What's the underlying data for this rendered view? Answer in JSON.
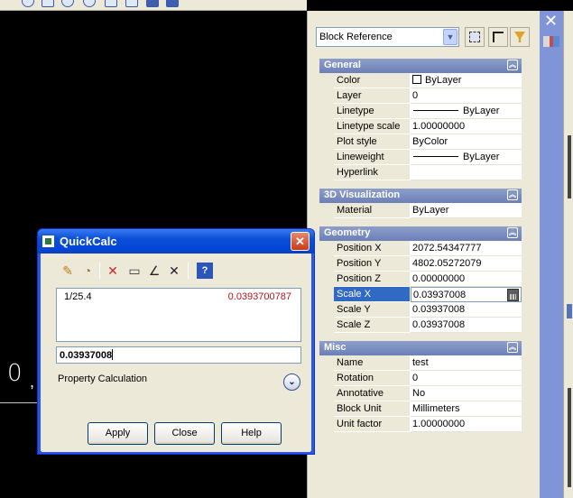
{
  "toolbar": {
    "icons": [
      "circle-icon",
      "rectangle-icon",
      "help-icon",
      "help-icon",
      "layers-icon",
      "window-icon",
      "save-icon",
      "save-icon"
    ]
  },
  "canvas": {
    "glyph_zero": "0",
    "glyph_comma": ","
  },
  "palette": {
    "object_type": "Block Reference",
    "sections": {
      "general": {
        "title": "General",
        "rows": [
          {
            "name": "Color",
            "value": "ByLayer"
          },
          {
            "name": "Layer",
            "value": "0"
          },
          {
            "name": "Linetype",
            "value": "ByLayer"
          },
          {
            "name": "Linetype scale",
            "value": "1.00000000"
          },
          {
            "name": "Plot style",
            "value": "ByColor"
          },
          {
            "name": "Lineweight",
            "value": "ByLayer"
          },
          {
            "name": "Hyperlink",
            "value": ""
          }
        ]
      },
      "viz3d": {
        "title": "3D Visualization",
        "rows": [
          {
            "name": "Material",
            "value": "ByLayer"
          }
        ]
      },
      "geometry": {
        "title": "Geometry",
        "rows": [
          {
            "name": "Position X",
            "value": "2072.54347777"
          },
          {
            "name": "Position Y",
            "value": "4802.05272079"
          },
          {
            "name": "Position Z",
            "value": "0.00000000"
          },
          {
            "name": "Scale X",
            "value": "0.03937008"
          },
          {
            "name": "Scale Y",
            "value": "0.03937008"
          },
          {
            "name": "Scale Z",
            "value": "0.03937008"
          }
        ]
      },
      "misc": {
        "title": "Misc",
        "rows": [
          {
            "name": "Name",
            "value": "test"
          },
          {
            "name": "Rotation",
            "value": "0"
          },
          {
            "name": "Annotative",
            "value": "No"
          },
          {
            "name": "Block Unit",
            "value": "Millimeters"
          },
          {
            "name": "Unit factor",
            "value": "1.00000000"
          }
        ]
      }
    }
  },
  "quickcalc": {
    "title": "QuickCalc",
    "history": {
      "expression": "1/25.4",
      "result": "0.0393700787"
    },
    "input_value": "0.03937008",
    "property_calc_label": "Property Calculation",
    "buttons": {
      "apply": "Apply",
      "close": "Close",
      "help": "Help"
    }
  },
  "colors": {
    "title_bar": "#0a4fd6",
    "selection": "#316ac5",
    "section_header": "#7a8dc2",
    "result_text": "#b0181f",
    "palette_strip": "#7f95d8"
  }
}
